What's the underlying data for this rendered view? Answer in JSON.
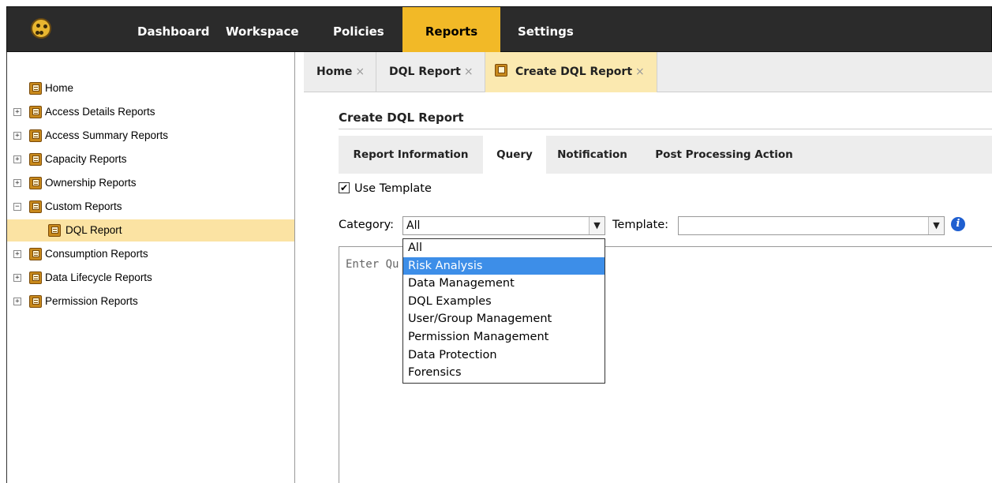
{
  "nav": {
    "items": [
      {
        "label": "Dashboard",
        "active": false
      },
      {
        "label": "Workspace",
        "active": false
      },
      {
        "label": "Policies",
        "active": false
      },
      {
        "label": "Reports",
        "active": true
      },
      {
        "label": "Settings",
        "active": false
      }
    ]
  },
  "sidebar": {
    "items": [
      {
        "label": "Home",
        "expander": "",
        "selected": false
      },
      {
        "label": "Access Details Reports",
        "expander": "+",
        "selected": false
      },
      {
        "label": "Access Summary Reports",
        "expander": "+",
        "selected": false
      },
      {
        "label": "Capacity Reports",
        "expander": "+",
        "selected": false
      },
      {
        "label": "Ownership Reports",
        "expander": "+",
        "selected": false
      },
      {
        "label": "Custom Reports",
        "expander": "−",
        "selected": false
      },
      {
        "label": "DQL Report",
        "expander": "",
        "selected": true
      },
      {
        "label": "Consumption Reports",
        "expander": "+",
        "selected": false
      },
      {
        "label": "Data Lifecycle Reports",
        "expander": "+",
        "selected": false
      },
      {
        "label": "Permission Reports",
        "expander": "+",
        "selected": false
      }
    ]
  },
  "tabs": [
    {
      "label": "Home",
      "close": "×",
      "active": false
    },
    {
      "label": "DQL Report",
      "close": "×",
      "active": false
    },
    {
      "label": "Create DQL Report",
      "close": "×",
      "active": true
    }
  ],
  "page": {
    "heading": "Create DQL Report",
    "subtabs": [
      {
        "label": "Report Information",
        "active": false
      },
      {
        "label": "Query",
        "active": true
      },
      {
        "label": "Notification",
        "active": false
      },
      {
        "label": "Post Processing Action",
        "active": false
      }
    ],
    "use_template": {
      "label": "Use Template",
      "checked": true,
      "mark": "✔"
    },
    "category": {
      "label": "Category:",
      "value": "All",
      "arrow": "▼"
    },
    "template": {
      "label": "Template:",
      "value": "",
      "arrow": "▼"
    },
    "info": "i",
    "query_placeholder": "Enter Qu",
    "dropdown": {
      "options": [
        "All",
        "Risk Analysis",
        "Data Management",
        "DQL Examples",
        "User/Group Management",
        "Permission Management",
        "Data Protection",
        "Forensics"
      ],
      "highlighted_index": 1
    }
  },
  "colors": {
    "accent": "#f2b927",
    "topbar": "#2b2b2b",
    "selected_row": "#fbe3a3",
    "highlight": "#3d8ee8",
    "info": "#1f5fd0"
  }
}
